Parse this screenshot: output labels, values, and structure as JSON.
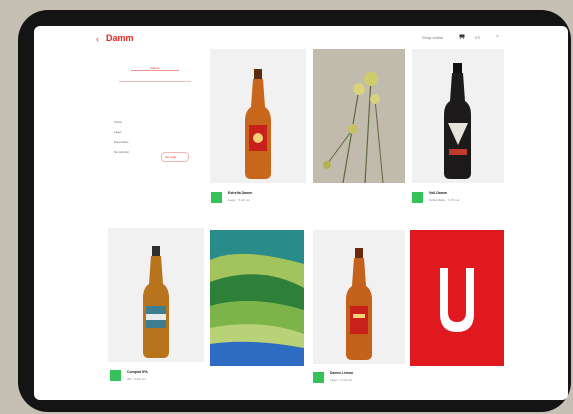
{
  "header": {
    "logo": "Damm",
    "back_icon": "chevron-left-icon",
    "nav_link": "Shop online",
    "language": "ES",
    "close_icon": "close-icon"
  },
  "sidebar": {
    "brand_small": "Damm",
    "filters": [
      "Todos",
      "Lager",
      "Especiales",
      "Sin Alcohol"
    ],
    "active_filter_badge": "Ver todo"
  },
  "products": [
    {
      "title": "Estrella Damm",
      "subtitle": "Lager · 5,4% vol",
      "kind": "amber-red-label"
    },
    {
      "title": "Voll-Damm",
      "subtitle": "Doble Malta · 7,2% vol",
      "kind": "dark-stout"
    },
    {
      "title": "Complot IPA",
      "subtitle": "IPA · 6,6% vol",
      "kind": "amber-blue-label"
    },
    {
      "title": "Damm Lemon",
      "subtitle": "Lager · 5,4% vol",
      "kind": "amber-red-label-2"
    }
  ],
  "colors": {
    "brand_red": "#e0281d",
    "badge_green": "#34c259",
    "tablet_frame": "#141414",
    "backdrop": "#c6bfb3"
  }
}
